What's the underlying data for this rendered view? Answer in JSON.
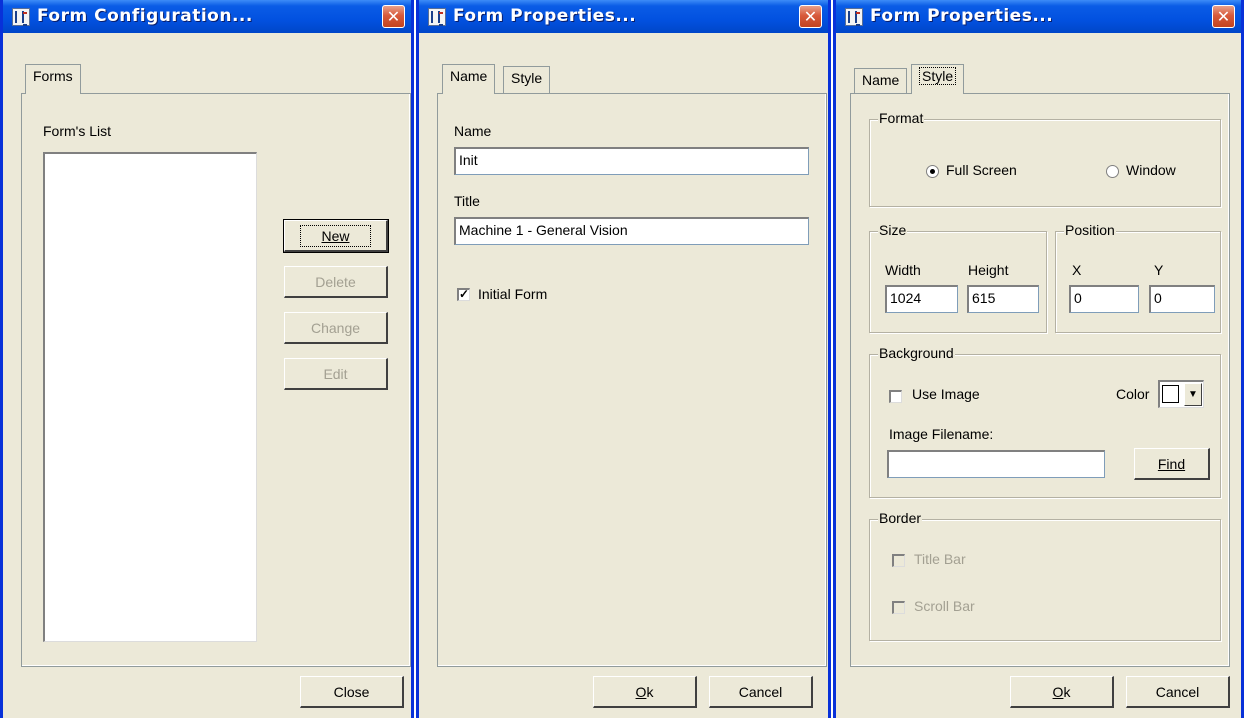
{
  "windows": [
    {
      "title": "Form Configuration...",
      "tabs": [
        "Forms"
      ],
      "list_label": "Form's List",
      "buttons": {
        "new": "New",
        "delete": "Delete",
        "change": "Change",
        "edit": "Edit",
        "close": "Close"
      }
    },
    {
      "title": "Form Properties...",
      "tabs": [
        "Name",
        "Style"
      ],
      "name_label": "Name",
      "name_value": "Init",
      "title_label": "Title",
      "title_value": "Machine 1 - General Vision",
      "initial_form_label": "Initial Form",
      "initial_form_checked": true,
      "buttons": {
        "ok": "Ok",
        "cancel": "Cancel"
      }
    },
    {
      "title": "Form Properties...",
      "tabs": [
        "Name",
        "Style"
      ],
      "format": {
        "legend": "Format",
        "full_screen": "Full Screen",
        "window": "Window",
        "selected": "Full Screen"
      },
      "size": {
        "legend": "Size",
        "width_label": "Width",
        "height_label": "Height",
        "width": "1024",
        "height": "615"
      },
      "position": {
        "legend": "Position",
        "x_label": "X",
        "y_label": "Y",
        "x": "0",
        "y": "0"
      },
      "background": {
        "legend": "Background",
        "use_image": "Use Image",
        "color_label": "Color",
        "filename_label": "Image Filename:",
        "filename": "",
        "find": "Find"
      },
      "border": {
        "legend": "Border",
        "title_bar": "Title Bar",
        "scroll_bar": "Scroll Bar"
      },
      "buttons": {
        "ok": "Ok",
        "cancel": "Cancel"
      }
    }
  ],
  "colors": {
    "titlebar": "#0251e0",
    "window_bg": "#ece9d8",
    "close": "#d85a3c"
  }
}
